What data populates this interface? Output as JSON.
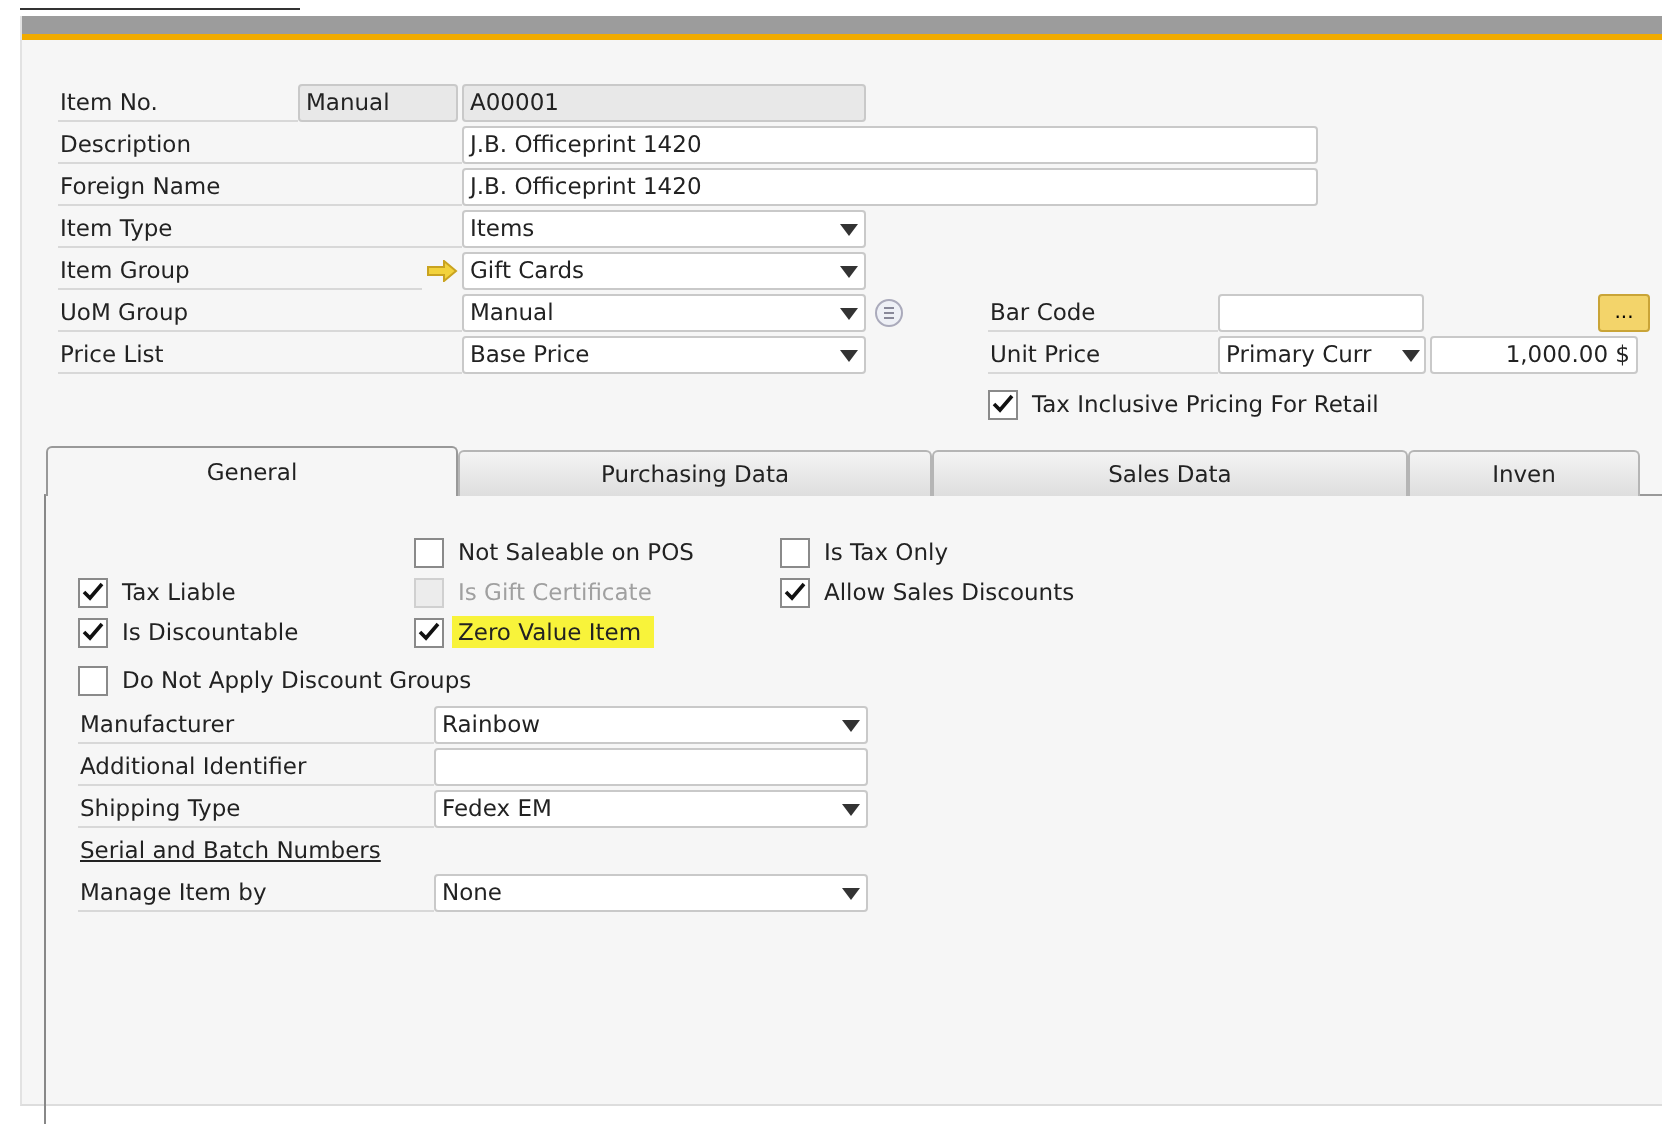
{
  "header_fields": [
    {
      "label": "Item No.",
      "kind": "series",
      "series": "Manual",
      "value": "A00001"
    },
    {
      "label": "Description",
      "kind": "wide",
      "value": "J.B. Officeprint 1420"
    },
    {
      "label": "Foreign Name",
      "kind": "wide",
      "value": "J.B. Officeprint 1420"
    },
    {
      "label": "Item Type",
      "kind": "dropdown",
      "value": "Items"
    },
    {
      "label": "Item Group",
      "kind": "dropdown",
      "value": "Gift Cards",
      "link_arrow": true
    },
    {
      "label": "UoM Group",
      "kind": "dropdown",
      "value": "Manual",
      "list_button": true
    },
    {
      "label": "Price List",
      "kind": "dropdown",
      "value": "Base Price"
    }
  ],
  "bar_code": {
    "label": "Bar Code",
    "browse_button": "..."
  },
  "unit_price": {
    "label": "Unit Price",
    "currency": "Primary Curr",
    "amount": "1,000.00 $"
  },
  "tax_inclusive": {
    "label": "Tax Inclusive Pricing For Retail",
    "checked": true
  },
  "tabs": [
    {
      "label": "General",
      "selected": true
    },
    {
      "label": "Purchasing Data",
      "selected": false
    },
    {
      "label": "Sales Data",
      "selected": false
    },
    {
      "label": "Inven",
      "selected": false
    }
  ],
  "options": {
    "columns": [
      [
        {
          "label": "Tax Liable",
          "checked": true,
          "disabled": false,
          "highlighted": false
        },
        {
          "label": "Is Discountable",
          "checked": true,
          "disabled": false,
          "highlighted": false
        }
      ],
      [
        {
          "label": "Not Saleable on POS",
          "checked": false,
          "disabled": false,
          "highlighted": false
        },
        {
          "label": "Is Gift Certificate",
          "checked": false,
          "disabled": true,
          "highlighted": false
        },
        {
          "label": "Zero Value Item",
          "checked": true,
          "disabled": false,
          "highlighted": true
        }
      ],
      [
        {
          "label": "Is Tax Only",
          "checked": false,
          "disabled": false,
          "highlighted": false
        },
        {
          "label": "Allow Sales Discounts",
          "checked": true,
          "disabled": false,
          "highlighted": false
        }
      ]
    ],
    "extra": [
      {
        "label": "Do Not Apply Discount Groups",
        "checked": false,
        "disabled": false,
        "highlighted": false
      }
    ]
  },
  "detail_fields": [
    {
      "kind": "dropdown",
      "label": "Manufacturer",
      "value": "Rainbow"
    },
    {
      "kind": "text",
      "label": "Additional Identifier"
    },
    {
      "kind": "dropdown",
      "label": "Shipping Type",
      "value": "Fedex EM"
    },
    {
      "kind": "section",
      "label": "Serial and Batch Numbers"
    },
    {
      "kind": "dropdown",
      "label": "Manage Item by",
      "value": "None"
    }
  ]
}
